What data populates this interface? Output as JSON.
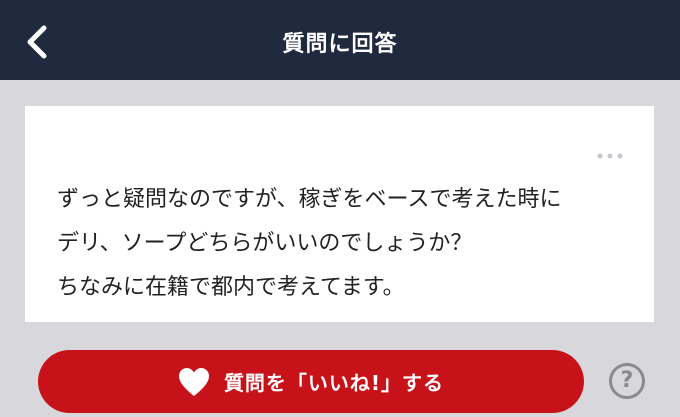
{
  "header": {
    "title": "質問に回答",
    "back_icon": "chevron-left-icon"
  },
  "question": {
    "lines": [
      "ずっと疑問なのですが、稼ぎをベースで考えた時に",
      "デリ、ソープどちらがいいのでしょうか？",
      "ちなみに在籍で都内で考えてます。"
    ],
    "more_icon": "more-dots-icon"
  },
  "like_button": {
    "label": "質問を「いいね!」する",
    "icon": "heart-icon"
  },
  "help_button": {
    "label": "?"
  },
  "colors": {
    "header_bg": "#1f2a3e",
    "page_bg": "#d7d7dc",
    "accent_red": "#c8121a"
  }
}
